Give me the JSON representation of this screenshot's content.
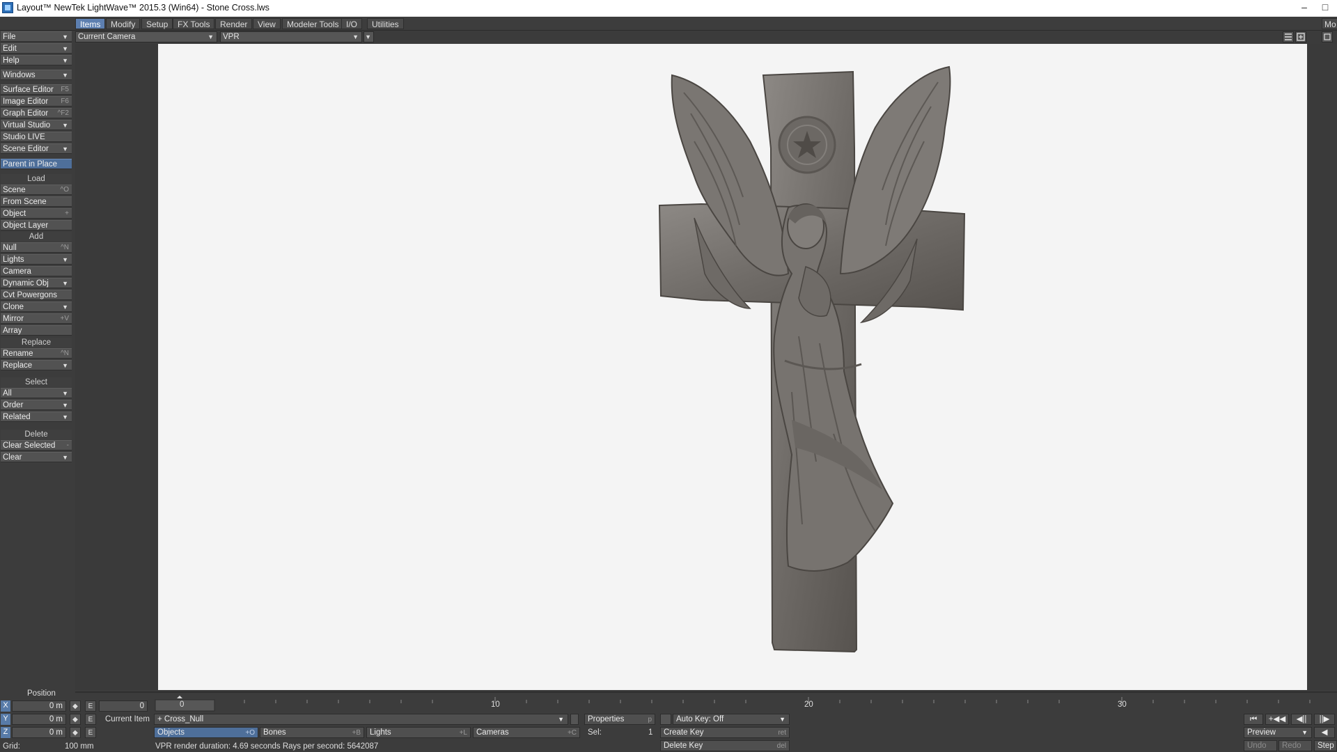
{
  "window": {
    "title": "Layout™ NewTek LightWave™ 2015.3 (Win64) - Stone Cross.lws",
    "minimize_glyph": "–",
    "maximize_glyph": "□"
  },
  "tabs": [
    "Items",
    "Modify",
    "Setup",
    "FX Tools",
    "Render",
    "View",
    "Modeler Tools",
    "I/O",
    "Utilities"
  ],
  "tab_right_label": "Mo",
  "viewport_header": {
    "view_select": "Current Camera",
    "render_mode": "VPR"
  },
  "toolbar": {
    "file": "File",
    "edit": "Edit",
    "help": "Help",
    "windows": "Windows",
    "surface_editor": {
      "label": "Surface Editor",
      "shortcut": "F5"
    },
    "image_editor": {
      "label": "Image Editor",
      "shortcut": "F6"
    },
    "graph_editor": {
      "label": "Graph Editor",
      "shortcut": "^F2"
    },
    "virtual_studio": "Virtual Studio",
    "studio_live": "Studio LIVE",
    "scene_editor": "Scene Editor",
    "parent_in_place": "Parent in Place",
    "load_header": "Load",
    "load_scene": {
      "label": "Scene",
      "shortcut": "^O"
    },
    "from_scene": "From Scene",
    "load_object": {
      "label": "Object",
      "shortcut": "+"
    },
    "object_layer": "Object Layer",
    "add_header": "Add",
    "add_null": {
      "label": "Null",
      "shortcut": "^N"
    },
    "add_lights": "Lights",
    "add_camera": "Camera",
    "dynamic_obj": "Dynamic Obj",
    "cvt_powergons": "Cvt Powergons",
    "clone": "Clone",
    "mirror": {
      "label": "Mirror",
      "shortcut": "+V"
    },
    "array": "Array",
    "replace_header": "Replace",
    "rename": {
      "label": "Rename",
      "shortcut": "^N"
    },
    "replace": "Replace",
    "select_header": "Select",
    "select_all": "All",
    "select_order": "Order",
    "select_related": "Related",
    "delete_header": "Delete",
    "clear_selected": {
      "label": "Clear Selected",
      "shortcut": "-"
    },
    "clear": "Clear"
  },
  "timeline": {
    "frame_marker": "0",
    "ticks": [
      "10",
      "20",
      "30"
    ]
  },
  "bottom": {
    "position_label": "Position",
    "x": {
      "axis": "X",
      "value": "0 m"
    },
    "y": {
      "axis": "Y",
      "value": "0 m"
    },
    "z": {
      "axis": "Z",
      "value": "0 m"
    },
    "env_label": "E",
    "arrows_label": "◆",
    "frame_value": "0",
    "current_item_label": "Current Item",
    "current_item_value": "Cross_Null",
    "properties": {
      "label": "Properties",
      "shortcut": "p"
    },
    "auto_key": "Auto Key: Off",
    "objects": {
      "label": "Objects",
      "shortcut": "+O"
    },
    "bones": {
      "label": "Bones",
      "shortcut": "+B"
    },
    "lights": {
      "label": "Lights",
      "shortcut": "+L"
    },
    "cameras": {
      "label": "Cameras",
      "shortcut": "+C"
    },
    "sel_label": "Sel:",
    "sel_value": "1",
    "create_key": {
      "label": "Create Key",
      "shortcut": "ret"
    },
    "delete_key": {
      "label": "Delete Key",
      "shortcut": "del"
    },
    "grid_label": "Grid:",
    "grid_value": "100 mm",
    "status": "VPR render duration: 4.69 seconds   Rays per second: 5642087",
    "preview": "Preview",
    "undo": "Undo",
    "redo": "Redo",
    "step": "Step"
  },
  "colors": {
    "accent_blue": "#4e6f9a",
    "viewport_bg": "#f4f4f4",
    "panel_bg": "#3c3c3c"
  }
}
